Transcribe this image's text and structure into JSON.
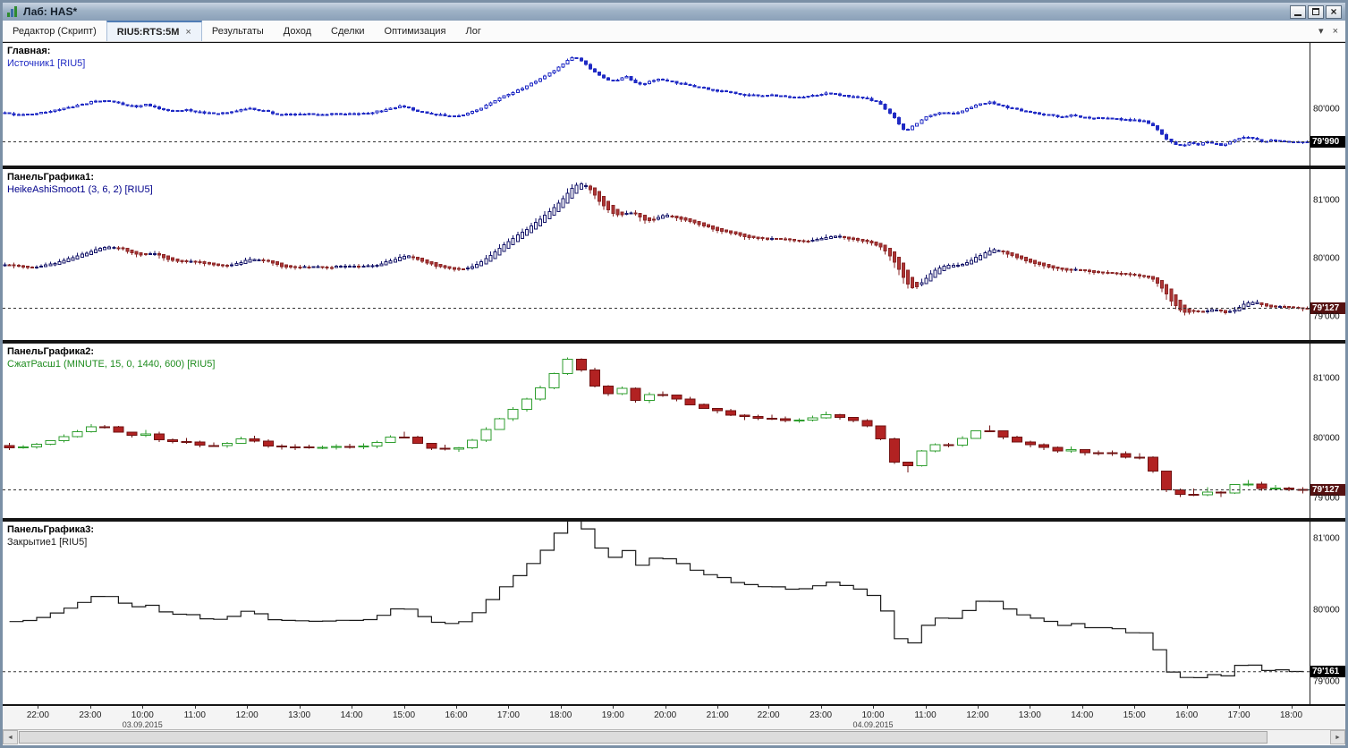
{
  "window": {
    "title": "Лаб: HAS*"
  },
  "tabbar": {
    "items": [
      {
        "label": "Редактор (Скрипт)",
        "active": false,
        "closable": false
      },
      {
        "label": "RIU5:RTS:5M",
        "active": true,
        "closable": true
      },
      {
        "label": "Результаты",
        "active": false,
        "closable": false
      },
      {
        "label": "Доход",
        "active": false,
        "closable": false
      },
      {
        "label": "Сделки",
        "active": false,
        "closable": false
      },
      {
        "label": "Оптимизация",
        "active": false,
        "closable": false
      },
      {
        "label": "Лог",
        "active": false,
        "closable": false
      }
    ],
    "tab_close_glyph": "×",
    "menu_glyph": "▾",
    "pane_close_glyph": "×"
  },
  "panels": [
    {
      "name": "Главная:",
      "source": "Источник1 [RIU5]",
      "source_color": "#1f2ac4",
      "badge": "79'990",
      "badge_bg": "#000000",
      "ticks": [
        {
          "label": "80'000",
          "price": 80000
        }
      ]
    },
    {
      "name": "ПанельГрафика1:",
      "source": "HeikeAshiSmoot1 (3, 6, 2) [RIU5]",
      "source_color": "#00008b",
      "badge": "79'127",
      "badge_bg": "#551111",
      "ticks": [
        {
          "label": "81'000",
          "price": 81000
        },
        {
          "label": "80'000",
          "price": 80000
        },
        {
          "label": "79'000",
          "price": 79000
        }
      ]
    },
    {
      "name": "ПанельГрафика2:",
      "source": "СжатРасш1 (MINUTE, 15, 0, 1440, 600) [RIU5]",
      "source_color": "#1e8c1e",
      "badge": "79'127",
      "badge_bg": "#551111",
      "ticks": [
        {
          "label": "81'000",
          "price": 81000
        },
        {
          "label": "80'000",
          "price": 80000
        },
        {
          "label": "79'000",
          "price": 79000
        }
      ]
    },
    {
      "name": "ПанельГрафика3:",
      "source": "Закрытие1 [RIU5]",
      "source_color": "#1a1a1a",
      "badge": "79'161",
      "badge_bg": "#000000",
      "ticks": [
        {
          "label": "81'000",
          "price": 81000
        },
        {
          "label": "80'000",
          "price": 80000
        },
        {
          "label": "79'000",
          "price": 79000
        }
      ]
    }
  ],
  "scrollbar": {
    "left_glyph": "◄",
    "right_glyph": "►"
  },
  "chart_data": {
    "type": "candlestick",
    "symbol": "RIU5",
    "interval": "5M",
    "candle_count": 288,
    "compression_group": 3,
    "panel_kinds": [
      "source_candles",
      "heiken_ashi_smoothed",
      "compressed_15min",
      "close_step_line"
    ],
    "panel_ranges": [
      [
        78530,
        81700
      ],
      [
        78600,
        81540
      ],
      [
        78670,
        81580
      ],
      [
        78690,
        81240
      ]
    ],
    "last_values": {
      "source": "79'990",
      "heiken": "79'127",
      "compressed": "79'127",
      "close": "79'161"
    },
    "colors": {
      "source": "#1f2ac4",
      "ha_up": "#15156a",
      "ha_down": "#b03636",
      "ha_down_stroke": "#8a2525",
      "comp_up": "#2f9e2f",
      "comp_down": "#b22222",
      "comp_down_stroke": "#701212",
      "line": "#1a1a1a",
      "dashed": "#333333"
    },
    "time_labels": [
      {
        "label": "22:00",
        "frac": 0.027
      },
      {
        "label": "23:00",
        "frac": 0.067
      },
      {
        "label": "10:00",
        "frac": 0.107
      },
      {
        "label": "11:00",
        "frac": 0.147
      },
      {
        "label": "12:00",
        "frac": 0.187
      },
      {
        "label": "13:00",
        "frac": 0.227
      },
      {
        "label": "14:00",
        "frac": 0.267
      },
      {
        "label": "15:00",
        "frac": 0.307
      },
      {
        "label": "16:00",
        "frac": 0.347
      },
      {
        "label": "17:00",
        "frac": 0.387
      },
      {
        "label": "18:00",
        "frac": 0.427
      },
      {
        "label": "19:00",
        "frac": 0.467
      },
      {
        "label": "20:00",
        "frac": 0.507
      },
      {
        "label": "21:00",
        "frac": 0.547
      },
      {
        "label": "22:00",
        "frac": 0.586
      },
      {
        "label": "23:00",
        "frac": 0.626
      },
      {
        "label": "10:00",
        "frac": 0.666
      },
      {
        "label": "11:00",
        "frac": 0.706
      },
      {
        "label": "12:00",
        "frac": 0.746
      },
      {
        "label": "13:00",
        "frac": 0.786
      },
      {
        "label": "14:00",
        "frac": 0.826
      },
      {
        "label": "15:00",
        "frac": 0.866
      },
      {
        "label": "16:00",
        "frac": 0.906
      },
      {
        "label": "17:00",
        "frac": 0.946
      },
      {
        "label": "18:00",
        "frac": 0.986
      }
    ],
    "date_labels": [
      {
        "label": "03.09.2015",
        "frac": 0.107
      },
      {
        "label": "04.09.2015",
        "frac": 0.666
      }
    ],
    "price_path": [
      [
        0.0,
        79880
      ],
      [
        0.012,
        79840
      ],
      [
        0.025,
        79880
      ],
      [
        0.04,
        79960
      ],
      [
        0.055,
        80070
      ],
      [
        0.068,
        80180
      ],
      [
        0.08,
        80210
      ],
      [
        0.09,
        80120
      ],
      [
        0.1,
        80060
      ],
      [
        0.108,
        80110
      ],
      [
        0.118,
        80010
      ],
      [
        0.128,
        79940
      ],
      [
        0.14,
        79970
      ],
      [
        0.152,
        79900
      ],
      [
        0.163,
        79870
      ],
      [
        0.175,
        79930
      ],
      [
        0.186,
        80010
      ],
      [
        0.196,
        79960
      ],
      [
        0.207,
        79870
      ],
      [
        0.218,
        79840
      ],
      [
        0.23,
        79870
      ],
      [
        0.243,
        79850
      ],
      [
        0.256,
        79870
      ],
      [
        0.268,
        79850
      ],
      [
        0.28,
        79890
      ],
      [
        0.292,
        79960
      ],
      [
        0.303,
        80060
      ],
      [
        0.312,
        79990
      ],
      [
        0.322,
        79890
      ],
      [
        0.333,
        79840
      ],
      [
        0.344,
        79810
      ],
      [
        0.354,
        79860
      ],
      [
        0.363,
        79960
      ],
      [
        0.372,
        80130
      ],
      [
        0.382,
        80300
      ],
      [
        0.392,
        80450
      ],
      [
        0.402,
        80600
      ],
      [
        0.411,
        80760
      ],
      [
        0.42,
        80950
      ],
      [
        0.428,
        81150
      ],
      [
        0.435,
        81320
      ],
      [
        0.441,
        81290
      ],
      [
        0.447,
        81090
      ],
      [
        0.453,
        80930
      ],
      [
        0.459,
        80800
      ],
      [
        0.465,
        80710
      ],
      [
        0.471,
        80760
      ],
      [
        0.477,
        80830
      ],
      [
        0.483,
        80700
      ],
      [
        0.489,
        80620
      ],
      [
        0.495,
        80710
      ],
      [
        0.502,
        80760
      ],
      [
        0.51,
        80720
      ],
      [
        0.518,
        80650
      ],
      [
        0.527,
        80590
      ],
      [
        0.536,
        80530
      ],
      [
        0.546,
        80470
      ],
      [
        0.557,
        80410
      ],
      [
        0.568,
        80360
      ],
      [
        0.579,
        80330
      ],
      [
        0.59,
        80350
      ],
      [
        0.601,
        80300
      ],
      [
        0.612,
        80280
      ],
      [
        0.622,
        80340
      ],
      [
        0.632,
        80400
      ],
      [
        0.642,
        80350
      ],
      [
        0.652,
        80310
      ],
      [
        0.66,
        80270
      ],
      [
        0.666,
        80220
      ],
      [
        0.672,
        80120
      ],
      [
        0.678,
        79950
      ],
      [
        0.683,
        79750
      ],
      [
        0.688,
        79520
      ],
      [
        0.691,
        79430
      ],
      [
        0.695,
        79500
      ],
      [
        0.7,
        79620
      ],
      [
        0.706,
        79760
      ],
      [
        0.713,
        79860
      ],
      [
        0.72,
        79910
      ],
      [
        0.727,
        79880
      ],
      [
        0.734,
        79930
      ],
      [
        0.74,
        80010
      ],
      [
        0.746,
        80080
      ],
      [
        0.752,
        80140
      ],
      [
        0.757,
        80160
      ],
      [
        0.763,
        80100
      ],
      [
        0.77,
        80030
      ],
      [
        0.778,
        79960
      ],
      [
        0.786,
        79920
      ],
      [
        0.794,
        79870
      ],
      [
        0.802,
        79830
      ],
      [
        0.81,
        79800
      ],
      [
        0.818,
        79820
      ],
      [
        0.826,
        79790
      ],
      [
        0.834,
        79760
      ],
      [
        0.842,
        79780
      ],
      [
        0.85,
        79740
      ],
      [
        0.858,
        79720
      ],
      [
        0.866,
        79700
      ],
      [
        0.874,
        79680
      ],
      [
        0.88,
        79600
      ],
      [
        0.886,
        79420
      ],
      [
        0.892,
        79200
      ],
      [
        0.898,
        79080
      ],
      [
        0.904,
        79040
      ],
      [
        0.91,
        79130
      ],
      [
        0.916,
        79070
      ],
      [
        0.922,
        79160
      ],
      [
        0.928,
        79090
      ],
      [
        0.934,
        79060
      ],
      [
        0.94,
        79130
      ],
      [
        0.947,
        79230
      ],
      [
        0.953,
        79290
      ],
      [
        0.959,
        79210
      ],
      [
        0.965,
        79150
      ],
      [
        0.971,
        79190
      ],
      [
        0.977,
        79160
      ],
      [
        0.984,
        79140
      ],
      [
        0.992,
        79135
      ],
      [
        1.0,
        79130
      ]
    ]
  }
}
